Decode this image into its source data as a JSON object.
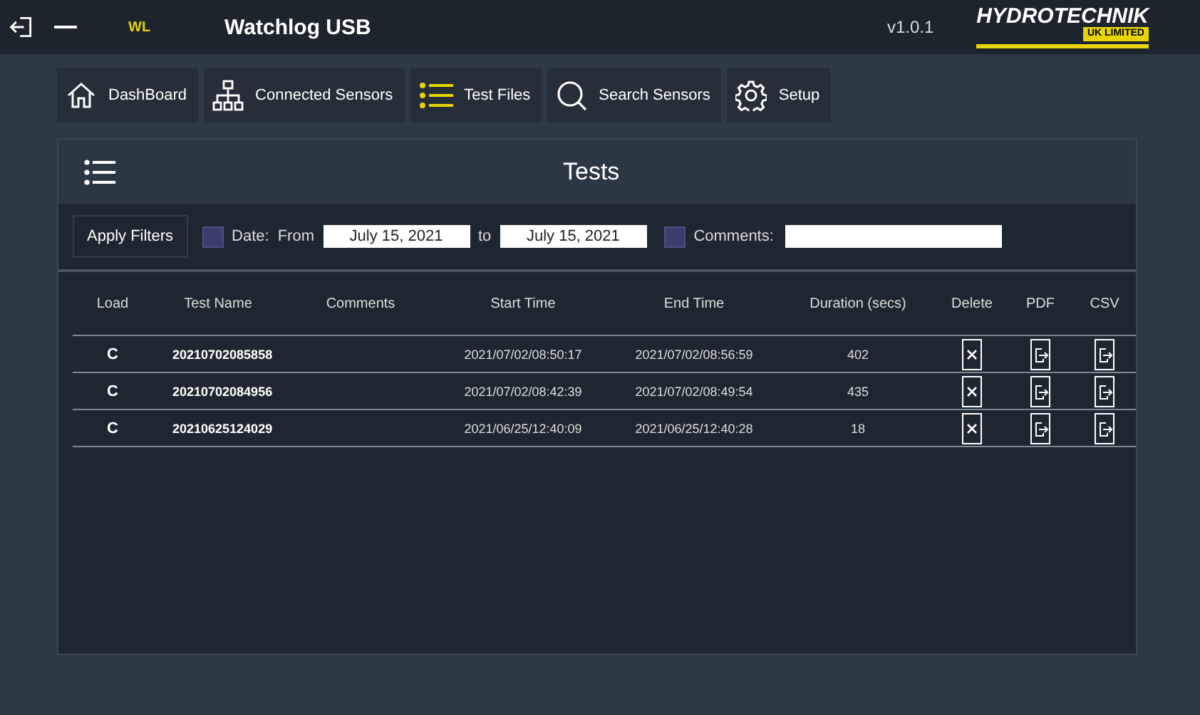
{
  "window": {
    "title": "Watchlog USB",
    "app_logo": "WL",
    "version": "v1.0.1",
    "brand": "HYDROTECHNIK",
    "brand_sub": "UK LIMITED"
  },
  "nav": [
    {
      "label": "DashBoard",
      "selected": false
    },
    {
      "label": "Connected Sensors",
      "selected": false
    },
    {
      "label": "Test Files",
      "selected": true
    },
    {
      "label": "Search Sensors",
      "selected": false
    },
    {
      "label": "Setup",
      "selected": false
    }
  ],
  "panel": {
    "title": "Tests"
  },
  "filters": {
    "apply_button": "Apply Filters",
    "date_checked": false,
    "date_label": "Date:",
    "from_label": "From",
    "from_value": "July 15, 2021",
    "to_label": "to",
    "to_value": "July 15, 2021",
    "comments_checked": false,
    "comments_label": "Comments:"
  },
  "table": {
    "columns": [
      "Load",
      "Test Name",
      "Comments",
      "Start Time",
      "End Time",
      "Duration (secs)",
      "Delete",
      "PDF",
      "CSV"
    ],
    "rows": [
      {
        "load": "C",
        "name": "20210702085858",
        "start": "2021/07/02/08:50:17",
        "end": "2021/07/02/08:56:59",
        "duration": "402"
      },
      {
        "load": "C",
        "name": "20210702084956",
        "start": "2021/07/02/08:42:39",
        "end": "2021/07/02/08:49:54",
        "duration": "435"
      },
      {
        "load": "C",
        "name": "20210625124029",
        "start": "2021/06/25/12:40:09",
        "end": "2021/06/25/12:40:28",
        "duration": "18"
      }
    ]
  }
}
